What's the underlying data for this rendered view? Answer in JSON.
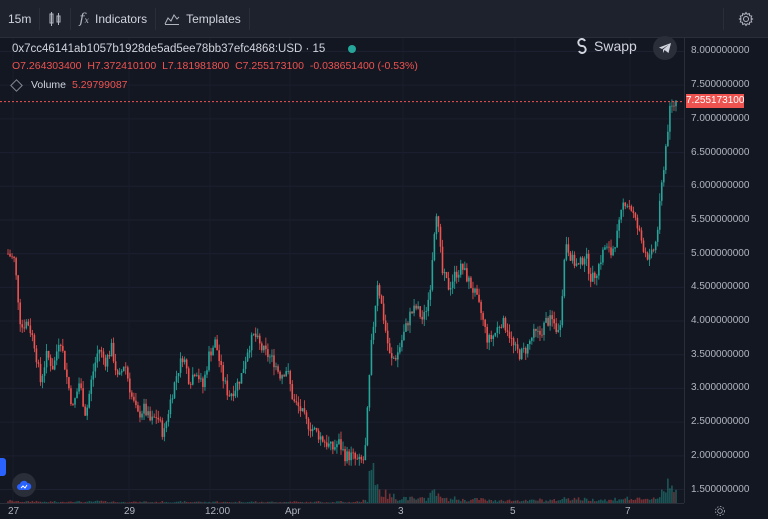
{
  "toolbar": {
    "interval": "15m",
    "indicators_label": "Indicators",
    "templates_label": "Templates"
  },
  "legend": {
    "symbol": "0x7cc46141ab1057b1928de5ad5ee78bb37efc4868:USD · 15",
    "open": "O7.264303400",
    "high": "H7.372410100",
    "low": "L7.181981800",
    "close": "C7.255173100",
    "change": "-0.038651400 (-0.53%)",
    "volume_label": "Volume",
    "volume_value": "5.29799087"
  },
  "brand": {
    "name": "Swapp"
  },
  "last_price_label": "7.255173100",
  "colors": {
    "up": "#26a69a",
    "down": "#ef5350",
    "bg": "#131722",
    "accent": "#2962ff"
  },
  "icons": [
    "candles-icon",
    "fx-icon",
    "templates-icon",
    "settings-icon",
    "telegram-icon",
    "swapp-logo-icon",
    "cloud-icon",
    "gear-icon"
  ],
  "chart_data": {
    "type": "candlestick",
    "price_ticks": [
      "8.000000000",
      "7.500000000",
      "7.000000000",
      "6.500000000",
      "6.000000000",
      "5.500000000",
      "5.000000000",
      "4.500000000",
      "4.000000000",
      "3.500000000",
      "3.000000000",
      "2.500000000",
      "2.000000000",
      "1.500000000"
    ],
    "time_ticks": [
      "27",
      "29",
      "12:00",
      "Apr",
      "3",
      "5",
      "7"
    ],
    "ylim": [
      1.3,
      8.2
    ],
    "close_path": [
      5.0,
      4.9,
      3.9,
      4.0,
      3.7,
      3.1,
      3.5,
      3.3,
      3.8,
      3.2,
      2.7,
      3.1,
      2.6,
      3.2,
      3.6,
      3.4,
      3.6,
      3.1,
      3.4,
      2.9,
      2.6,
      2.7,
      2.5,
      2.6,
      2.3,
      2.8,
      3.2,
      3.5,
      3.1,
      3.3,
      3.0,
      3.5,
      3.7,
      3.2,
      2.9,
      3.0,
      3.2,
      3.6,
      3.8,
      3.6,
      3.5,
      3.4,
      3.2,
      3.3,
      2.8,
      2.7,
      2.5,
      2.4,
      2.3,
      2.2,
      2.1,
      2.2,
      2.0,
      2.0,
      1.9,
      1.95,
      3.6,
      4.6,
      4.0,
      3.4,
      3.5,
      3.8,
      4.1,
      4.2,
      4.0,
      4.4,
      5.7,
      4.7,
      4.5,
      4.7,
      4.8,
      4.6,
      4.4,
      4.1,
      3.7,
      3.8,
      4.0,
      3.9,
      3.6,
      3.5,
      3.6,
      3.8,
      3.8,
      4.0,
      4.0,
      3.8,
      5.2,
      4.9,
      4.8,
      5.0,
      4.6,
      4.8,
      5.1,
      5.0,
      5.3,
      5.8,
      5.7,
      5.4,
      5.1,
      4.9,
      5.2,
      6.2,
      7.1,
      7.26
    ],
    "volume_spikes": [
      0.05,
      0.04,
      0.03,
      0.03,
      0.04,
      0.03,
      0.02,
      0.03,
      0.02,
      0.03,
      0.04,
      0.03,
      0.02,
      0.03,
      0.04,
      0.03,
      0.03,
      0.02,
      0.02,
      0.03,
      0.02,
      0.03,
      0.02,
      0.02,
      0.03,
      0.02,
      0.02,
      0.03,
      0.02,
      0.03,
      0.02,
      0.02,
      0.03,
      0.02,
      0.02,
      0.02,
      0.03,
      0.02,
      0.03,
      0.02,
      0.02,
      0.03,
      0.02,
      0.02,
      0.03,
      0.02,
      0.02,
      0.02,
      0.03,
      0.02,
      0.02,
      0.03,
      0.02,
      0.02,
      0.03,
      0.05,
      0.9,
      0.4,
      0.2,
      0.15,
      0.1,
      0.12,
      0.1,
      0.08,
      0.09,
      0.2,
      0.3,
      0.1,
      0.08,
      0.1,
      0.07,
      0.06,
      0.08,
      0.09,
      0.06,
      0.05,
      0.07,
      0.06,
      0.05,
      0.06,
      0.05,
      0.06,
      0.07,
      0.05,
      0.06,
      0.07,
      0.12,
      0.1,
      0.09,
      0.08,
      0.07,
      0.08,
      0.07,
      0.06,
      0.09,
      0.1,
      0.09,
      0.08,
      0.07,
      0.1,
      0.12,
      0.3,
      0.5,
      0.35
    ]
  }
}
